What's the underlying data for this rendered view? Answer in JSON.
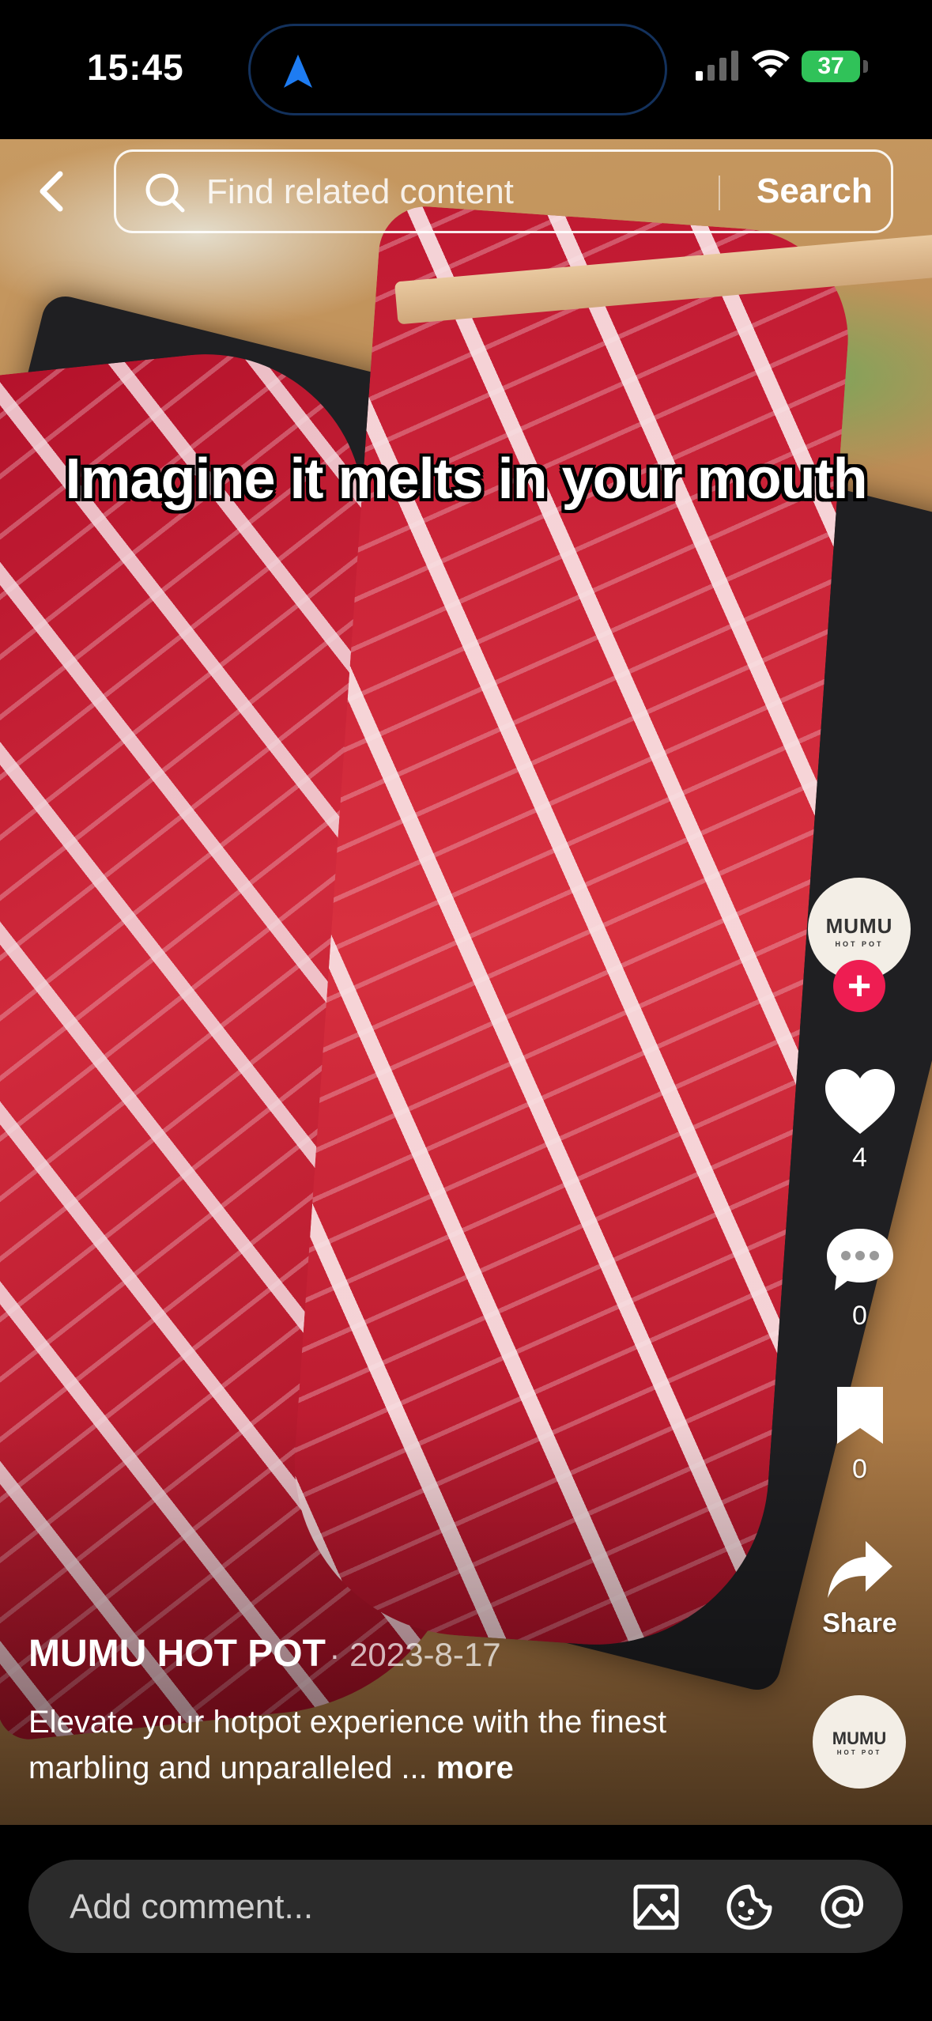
{
  "status_bar": {
    "time": "15:45",
    "battery": "37"
  },
  "search": {
    "placeholder": "Find related content",
    "button_label": "Search"
  },
  "video": {
    "caption": "Imagine it melts in your mouth"
  },
  "rail": {
    "avatar_brand": "MUMU",
    "avatar_sub": "HOT POT",
    "follow": "+",
    "likes": "4",
    "comments": "0",
    "saves": "0",
    "share_label": "Share"
  },
  "post": {
    "author": "MUMU HOT POT",
    "date": "· 2023-8-17",
    "description": "Elevate your hotpot experience with the finest marbling and unparalleled ...",
    "more_label": "more"
  },
  "comment": {
    "placeholder": "Add comment..."
  },
  "colors": {
    "follow": "#ee1d52",
    "battery": "#30c259",
    "island_border": "#13315c"
  }
}
